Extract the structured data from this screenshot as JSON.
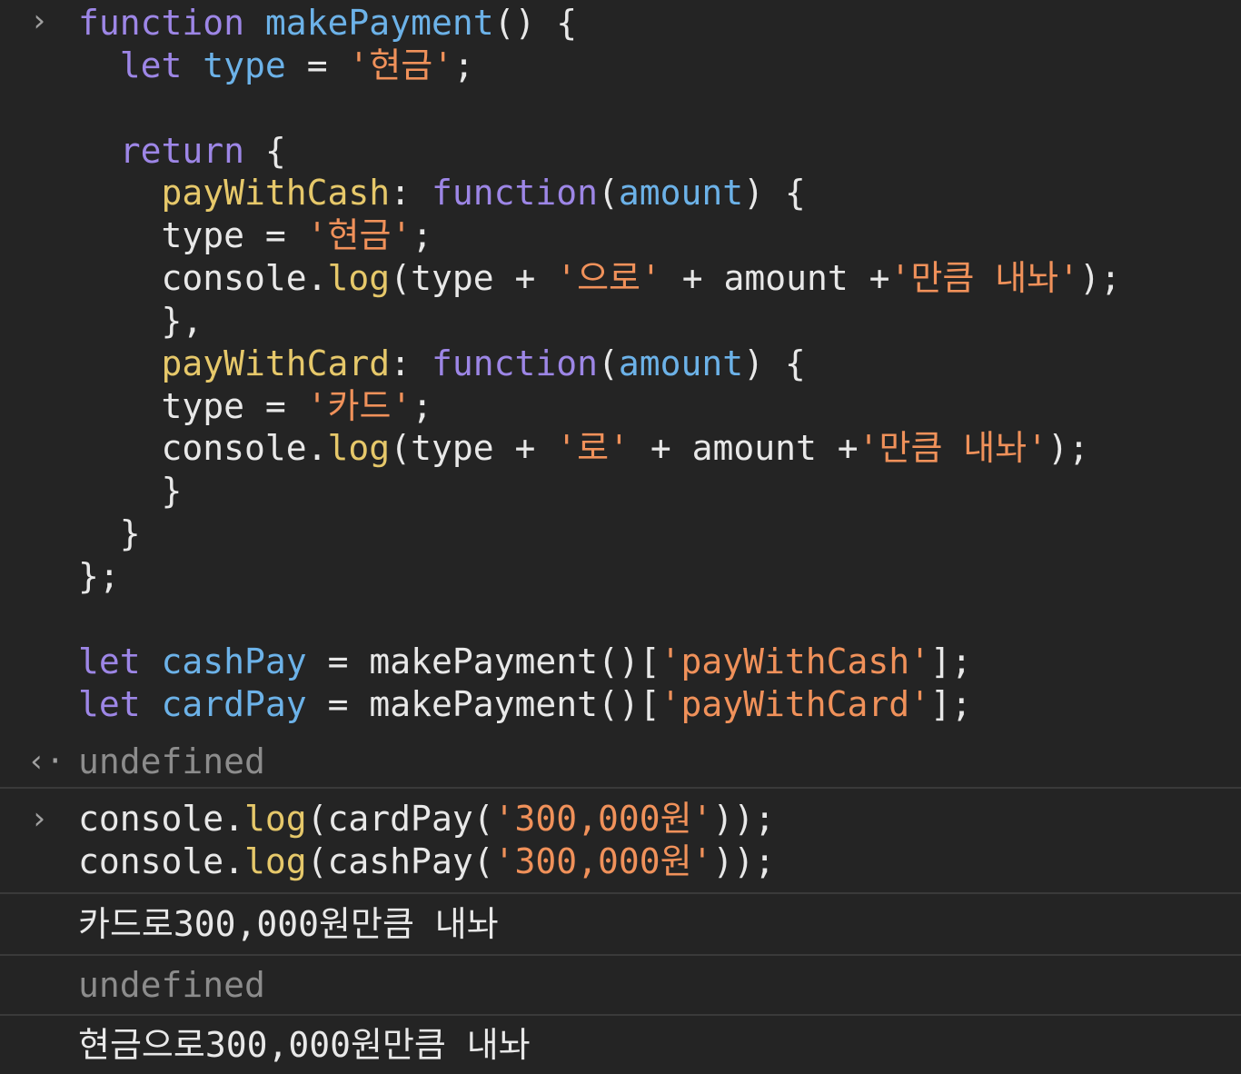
{
  "input_block_1": {
    "prompt_icon": "chevron-right-icon",
    "lines": [
      [
        {
          "t": "function",
          "c": "kw"
        },
        {
          "t": " ",
          "c": "plain"
        },
        {
          "t": "makePayment",
          "c": "fn"
        },
        {
          "t": "() {",
          "c": "punc"
        }
      ],
      [
        {
          "t": "  ",
          "c": "plain"
        },
        {
          "t": "let",
          "c": "kw"
        },
        {
          "t": " ",
          "c": "plain"
        },
        {
          "t": "type",
          "c": "var"
        },
        {
          "t": " = ",
          "c": "punc"
        },
        {
          "t": "'현금'",
          "c": "str"
        },
        {
          "t": ";",
          "c": "punc"
        }
      ],
      [],
      [
        {
          "t": "  ",
          "c": "plain"
        },
        {
          "t": "return",
          "c": "kw"
        },
        {
          "t": " {",
          "c": "punc"
        }
      ],
      [
        {
          "t": "    ",
          "c": "plain"
        },
        {
          "t": "payWithCash",
          "c": "prop"
        },
        {
          "t": ": ",
          "c": "punc"
        },
        {
          "t": "function",
          "c": "kw"
        },
        {
          "t": "(",
          "c": "punc"
        },
        {
          "t": "amount",
          "c": "var"
        },
        {
          "t": ") {",
          "c": "punc"
        }
      ],
      [
        {
          "t": "    type = ",
          "c": "plain"
        },
        {
          "t": "'현금'",
          "c": "str"
        },
        {
          "t": ";",
          "c": "punc"
        }
      ],
      [
        {
          "t": "    console.",
          "c": "plain"
        },
        {
          "t": "log",
          "c": "method"
        },
        {
          "t": "(type + ",
          "c": "plain"
        },
        {
          "t": "'으로'",
          "c": "str"
        },
        {
          "t": " + amount +",
          "c": "plain"
        },
        {
          "t": "'만큼 내놔'",
          "c": "str"
        },
        {
          "t": ");",
          "c": "punc"
        }
      ],
      [
        {
          "t": "    },",
          "c": "punc"
        }
      ],
      [
        {
          "t": "    ",
          "c": "plain"
        },
        {
          "t": "payWithCard",
          "c": "prop"
        },
        {
          "t": ": ",
          "c": "punc"
        },
        {
          "t": "function",
          "c": "kw"
        },
        {
          "t": "(",
          "c": "punc"
        },
        {
          "t": "amount",
          "c": "var"
        },
        {
          "t": ") {",
          "c": "punc"
        }
      ],
      [
        {
          "t": "    type = ",
          "c": "plain"
        },
        {
          "t": "'카드'",
          "c": "str"
        },
        {
          "t": ";",
          "c": "punc"
        }
      ],
      [
        {
          "t": "    console.",
          "c": "plain"
        },
        {
          "t": "log",
          "c": "method"
        },
        {
          "t": "(type + ",
          "c": "plain"
        },
        {
          "t": "'로'",
          "c": "str"
        },
        {
          "t": " + amount +",
          "c": "plain"
        },
        {
          "t": "'만큼 내놔'",
          "c": "str"
        },
        {
          "t": ");",
          "c": "punc"
        }
      ],
      [
        {
          "t": "    }",
          "c": "punc"
        }
      ],
      [
        {
          "t": "  }",
          "c": "punc"
        }
      ],
      [
        {
          "t": "};",
          "c": "punc"
        }
      ],
      [],
      [
        {
          "t": "let",
          "c": "kw"
        },
        {
          "t": " ",
          "c": "plain"
        },
        {
          "t": "cashPay",
          "c": "var"
        },
        {
          "t": " = makePayment()[",
          "c": "plain"
        },
        {
          "t": "'payWithCash'",
          "c": "str"
        },
        {
          "t": "];",
          "c": "punc"
        }
      ],
      [
        {
          "t": "let",
          "c": "kw"
        },
        {
          "t": " ",
          "c": "plain"
        },
        {
          "t": "cardPay",
          "c": "var"
        },
        {
          "t": " = makePayment()[",
          "c": "plain"
        },
        {
          "t": "'payWithCard'",
          "c": "str"
        },
        {
          "t": "];",
          "c": "punc"
        }
      ]
    ]
  },
  "result_1": {
    "prompt_icon": "return-arrow-icon",
    "text": "undefined"
  },
  "input_block_2": {
    "prompt_icon": "chevron-right-icon",
    "lines": [
      [
        {
          "t": "console.",
          "c": "plain"
        },
        {
          "t": "log",
          "c": "method"
        },
        {
          "t": "(cardPay(",
          "c": "plain"
        },
        {
          "t": "'300,000원'",
          "c": "str"
        },
        {
          "t": "));",
          "c": "punc"
        }
      ],
      [
        {
          "t": "console.",
          "c": "plain"
        },
        {
          "t": "log",
          "c": "method"
        },
        {
          "t": "(cashPay(",
          "c": "plain"
        },
        {
          "t": "'300,000원'",
          "c": "str"
        },
        {
          "t": "));",
          "c": "punc"
        }
      ]
    ]
  },
  "output_1": {
    "text": "카드로300,000원만큼 내놔"
  },
  "output_2": {
    "text": "undefined"
  },
  "output_3": {
    "text": "현금으로300,000원만큼 내놔"
  }
}
